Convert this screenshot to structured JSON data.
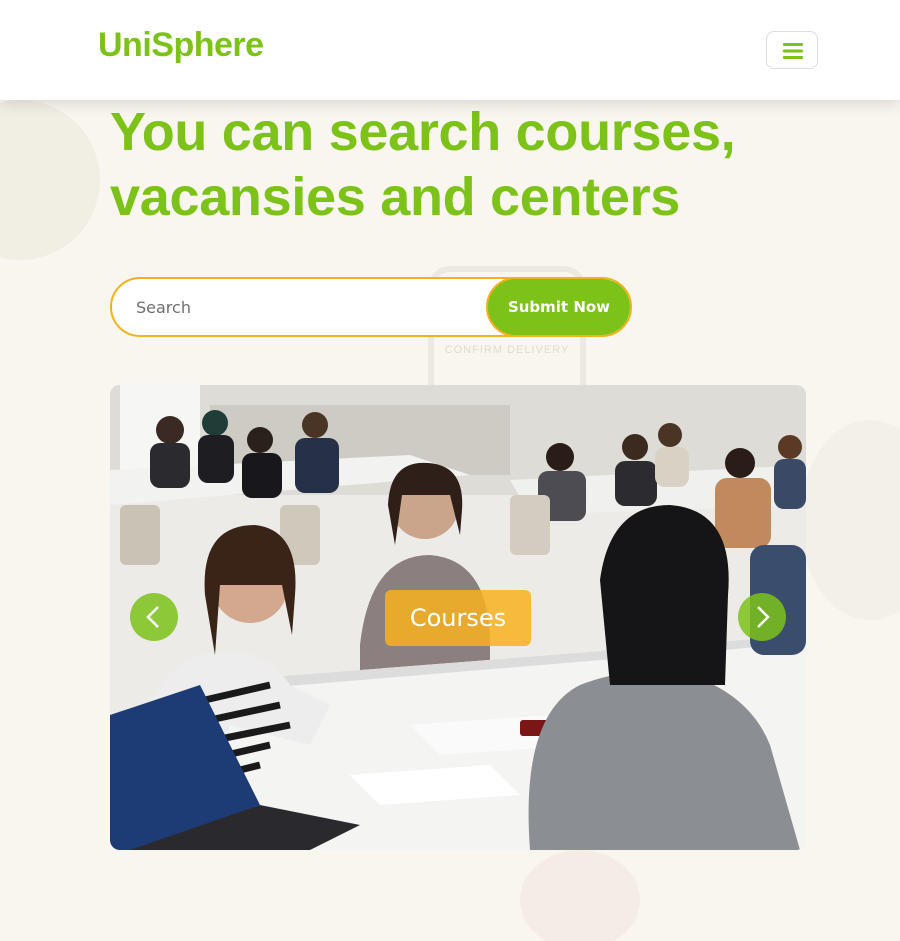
{
  "header": {
    "brand": "UniSphere",
    "menu_icon": "hamburger-icon"
  },
  "hero": {
    "title_line1": "You can search courses,",
    "title_line2": "vacansies and centers"
  },
  "search": {
    "placeholder": "Search",
    "value": "",
    "submit_label": "Submit Now"
  },
  "carousel": {
    "slide_caption": "Courses",
    "prev_icon": "chevron-left-icon",
    "next_icon": "chevron-right-icon",
    "image_subject": "students-classroom-photo"
  },
  "background": {
    "phone_text": "CONFIRM DELIVERY"
  },
  "colors": {
    "brand_green": "#7cc219",
    "accent_orange": "#f2b21e",
    "background": "#f8f6ee"
  }
}
